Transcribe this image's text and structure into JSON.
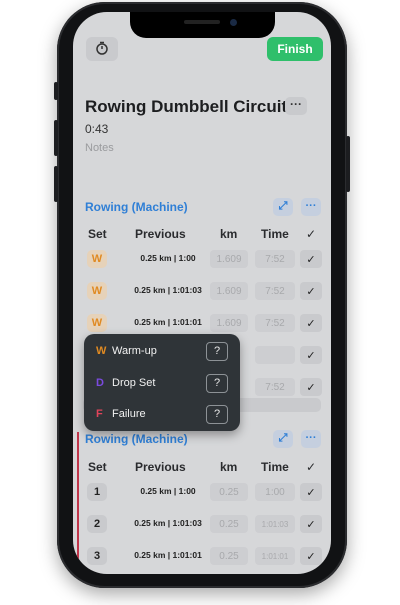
{
  "header": {
    "finish_label": "Finish"
  },
  "workout": {
    "title": "Rowing Dumbbell Circuit",
    "more": "···",
    "elapsed": "0:43",
    "notes_placeholder": "Notes"
  },
  "columns": {
    "set": "Set",
    "previous": "Previous",
    "km": "km",
    "time": "Time",
    "check": "✓"
  },
  "exercise1": {
    "name": "Rowing (Machine)",
    "rows": [
      {
        "set": "W",
        "previous": "0.25 km | 1:00",
        "km": "1.609",
        "time": "7:52"
      },
      {
        "set": "W",
        "previous": "0.25 km | 1:01:03",
        "km": "1.609",
        "time": "7:52"
      },
      {
        "set": "W",
        "previous": "0.25 km | 1:01:01",
        "km": "1.609",
        "time": "7:52"
      },
      {
        "set": "",
        "previous": "",
        "km": "",
        "time": ""
      },
      {
        "set": "",
        "previous": "",
        "km": "",
        "time": "7:52"
      }
    ]
  },
  "exercise2": {
    "name": "Rowing (Machine)",
    "rows": [
      {
        "set": "1",
        "previous": "0.25 km | 1:00",
        "km": "0.25",
        "time": "1:00"
      },
      {
        "set": "2",
        "previous": "0.25 km | 1:01:03",
        "km": "0.25",
        "time": "1:01:03"
      },
      {
        "set": "3",
        "previous": "0.25 km | 1:01:01",
        "km": "0.25",
        "time": "1:01:01"
      }
    ]
  },
  "set_type_menu": {
    "items": [
      {
        "letter": "W",
        "label": "Warm-up",
        "color": "#e08a22",
        "help": "?"
      },
      {
        "letter": "D",
        "label": "Drop Set",
        "color": "#7b4ae0",
        "help": "?"
      },
      {
        "letter": "F",
        "label": "Failure",
        "color": "#e0445a",
        "help": "?"
      }
    ]
  },
  "colors": {
    "accent": "#2f7fd6",
    "finish": "#2fbf6b",
    "warmup": "#e08a22"
  }
}
